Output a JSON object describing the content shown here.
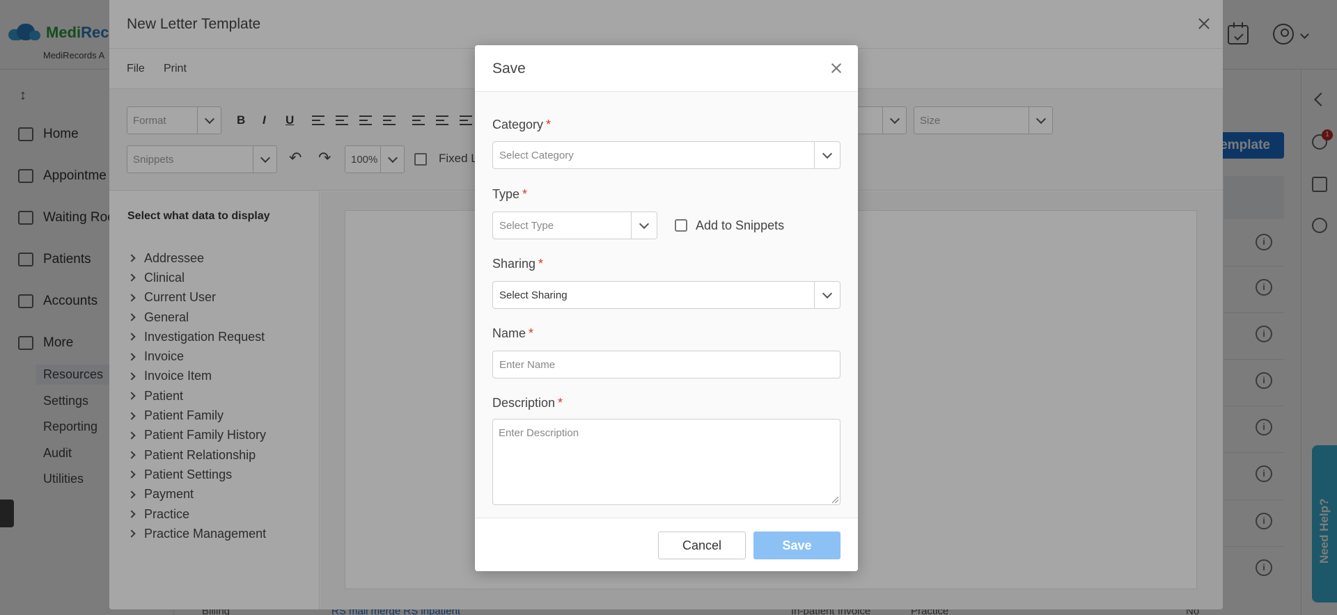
{
  "app": {
    "brand_visible": "MediRec",
    "brand_green": "Medi",
    "brand_blue": "Rec",
    "subtitle": "MediRecords A"
  },
  "sidebar": {
    "items": [
      {
        "label": "Home",
        "icon": "home-icon"
      },
      {
        "label": "Appointme",
        "icon": "calendar-icon"
      },
      {
        "label": "Waiting Roo",
        "icon": "users-icon"
      },
      {
        "label": "Patients",
        "icon": "patients-icon"
      },
      {
        "label": "Accounts",
        "icon": "folder-icon"
      },
      {
        "label": "More",
        "icon": "folder-plus-icon"
      }
    ],
    "sub_items": [
      "Resources",
      "Settings",
      "Reporting",
      "Audit",
      "Utilities"
    ],
    "active_sub": "Resources"
  },
  "main": {
    "new_template_btn": "emplate",
    "bottom_row": {
      "col1": "Billing",
      "col2": "RS mail merge RS inpatient",
      "col3": "In-patient Invoice",
      "col4": "Practice",
      "col5": "No"
    }
  },
  "right_rail": {
    "badge": "1",
    "need_help": "Need Help?"
  },
  "template_modal": {
    "title": "New Letter Template",
    "menu": [
      "File",
      "Print"
    ],
    "toolbar": {
      "format_placeholder": "Format",
      "snippets_placeholder": "Snippets",
      "zoom": "100%",
      "fixed_label": "Fixed L",
      "size_placeholder": "Size",
      "bold": "B",
      "italic": "I",
      "underline": "U"
    },
    "data_panel": {
      "title": "Select what data to display",
      "items": [
        "Addressee",
        "Clinical",
        "Current User",
        "General",
        "Investigation Request",
        "Invoice",
        "Invoice Item",
        "Patient",
        "Patient Family",
        "Patient Family History",
        "Patient Relationship",
        "Patient Settings",
        "Payment",
        "Practice",
        "Practice Management"
      ]
    }
  },
  "save_dialog": {
    "title": "Save",
    "category": {
      "label": "Category",
      "placeholder": "Select Category"
    },
    "type": {
      "label": "Type",
      "placeholder": "Select Type"
    },
    "snippets_label": "Add to Snippets",
    "sharing": {
      "label": "Sharing",
      "value": "Select Sharing"
    },
    "name": {
      "label": "Name",
      "placeholder": "Enter Name"
    },
    "description": {
      "label": "Description",
      "placeholder": "Enter Description"
    },
    "required_mark": "*",
    "cancel": "Cancel",
    "save": "Save"
  },
  "colors": {
    "primary": "#1c6fd1",
    "save_disabled": "#8cc1f5",
    "required": "#d9342b",
    "brand_green": "#2e9e3d",
    "brand_blue": "#2b7fc0"
  }
}
